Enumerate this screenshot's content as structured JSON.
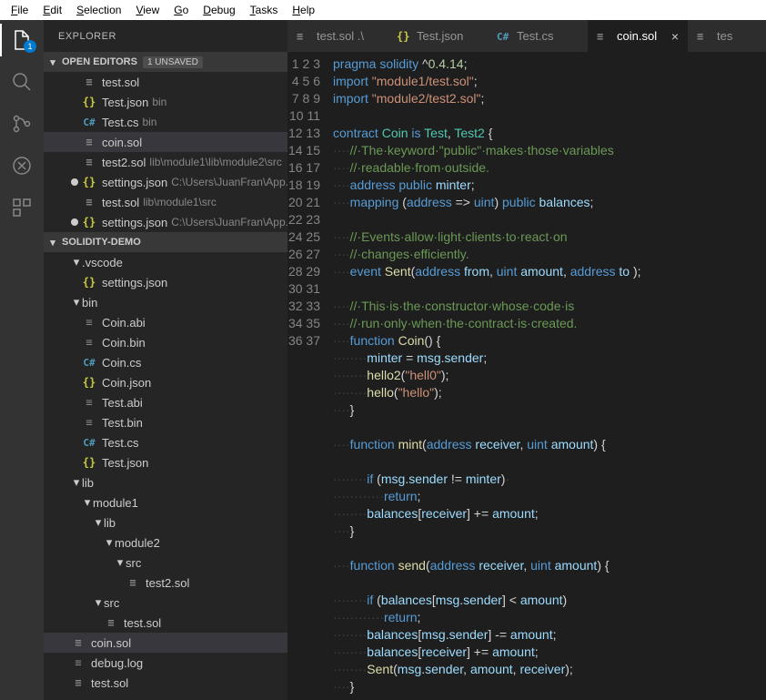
{
  "menu": [
    "File",
    "Edit",
    "Selection",
    "View",
    "Go",
    "Debug",
    "Tasks",
    "Help"
  ],
  "activity": {
    "badge": "1"
  },
  "sidebar": {
    "title": "EXPLORER",
    "openEditors": {
      "label": "OPEN EDITORS",
      "tag": "1 UNSAVED"
    },
    "editors": [
      {
        "icon": "sol",
        "name": "test.sol",
        "hint": ""
      },
      {
        "icon": "json",
        "name": "Test.json",
        "hint": "bin"
      },
      {
        "icon": "cs",
        "name": "Test.cs",
        "hint": "bin"
      },
      {
        "icon": "sol",
        "name": "coin.sol",
        "hint": "",
        "sel": true
      },
      {
        "icon": "sol",
        "name": "test2.sol",
        "hint": "lib\\module1\\lib\\module2\\src"
      },
      {
        "icon": "json",
        "name": "settings.json",
        "hint": "C:\\Users\\JuanFran\\App...",
        "dirty": true
      },
      {
        "icon": "sol",
        "name": "test.sol",
        "hint": "lib\\module1\\src"
      },
      {
        "icon": "json",
        "name": "settings.json",
        "hint": "C:\\Users\\JuanFran\\App...",
        "dirty": true
      }
    ],
    "project": {
      "label": "SOLIDITY-DEMO"
    },
    "tree": [
      {
        "d": 1,
        "t": "folder-open",
        "l": ".vscode"
      },
      {
        "d": 2,
        "t": "json",
        "l": "settings.json"
      },
      {
        "d": 1,
        "t": "folder-open",
        "l": "bin"
      },
      {
        "d": 2,
        "t": "file",
        "l": "Coin.abi"
      },
      {
        "d": 2,
        "t": "file",
        "l": "Coin.bin"
      },
      {
        "d": 2,
        "t": "cs",
        "l": "Coin.cs"
      },
      {
        "d": 2,
        "t": "json",
        "l": "Coin.json"
      },
      {
        "d": 2,
        "t": "file",
        "l": "Test.abi"
      },
      {
        "d": 2,
        "t": "file",
        "l": "Test.bin"
      },
      {
        "d": 2,
        "t": "cs",
        "l": "Test.cs"
      },
      {
        "d": 2,
        "t": "json",
        "l": "Test.json"
      },
      {
        "d": 1,
        "t": "folder-open",
        "l": "lib"
      },
      {
        "d": 2,
        "t": "folder-open",
        "l": "module1"
      },
      {
        "d": 3,
        "t": "folder-open",
        "l": "lib"
      },
      {
        "d": 4,
        "t": "folder-open",
        "l": "module2"
      },
      {
        "d": 5,
        "t": "folder-open",
        "l": "src"
      },
      {
        "d": 6,
        "t": "sol",
        "l": "test2.sol"
      },
      {
        "d": 3,
        "t": "folder-open",
        "l": "src"
      },
      {
        "d": 4,
        "t": "sol",
        "l": "test.sol"
      },
      {
        "d": 1,
        "t": "sol",
        "l": "coin.sol",
        "sel": true
      },
      {
        "d": 1,
        "t": "file",
        "l": "debug.log"
      },
      {
        "d": 1,
        "t": "sol",
        "l": "test.sol"
      }
    ]
  },
  "tabs": [
    {
      "icon": "sol",
      "label": "test.sol .\\"
    },
    {
      "icon": "json",
      "label": "Test.json"
    },
    {
      "icon": "cs",
      "label": "Test.cs"
    },
    {
      "icon": "sol",
      "label": "coin.sol",
      "active": true
    },
    {
      "icon": "sol",
      "label": "tes"
    }
  ],
  "code": [
    [
      [
        "k",
        "pragma"
      ],
      [
        "p",
        " "
      ],
      [
        "k",
        "solidity"
      ],
      [
        "p",
        " ^"
      ],
      [
        "n",
        "0.4.14"
      ],
      [
        "p",
        ";"
      ]
    ],
    [
      [
        "k",
        "import"
      ],
      [
        "p",
        " "
      ],
      [
        "s",
        "\"module1/test.sol\""
      ],
      [
        "p",
        ";"
      ]
    ],
    [
      [
        "k",
        "import"
      ],
      [
        "p",
        " "
      ],
      [
        "s",
        "\"module2/test2.sol\""
      ],
      [
        "p",
        ";"
      ]
    ],
    [],
    [
      [
        "k",
        "contract"
      ],
      [
        "p",
        " "
      ],
      [
        "t",
        "Coin"
      ],
      [
        "p",
        " "
      ],
      [
        "k",
        "is"
      ],
      [
        "p",
        " "
      ],
      [
        "t",
        "Test"
      ],
      [
        "p",
        ", "
      ],
      [
        "t",
        "Test2"
      ],
      [
        "p",
        " {"
      ]
    ],
    [
      [
        "ws",
        "····"
      ],
      [
        "c",
        "//·The·keyword·\"public\"·makes·those·variables"
      ]
    ],
    [
      [
        "ws",
        "····"
      ],
      [
        "c",
        "//·readable·from·outside."
      ]
    ],
    [
      [
        "ws",
        "····"
      ],
      [
        "k",
        "address"
      ],
      [
        "p",
        " "
      ],
      [
        "k",
        "public"
      ],
      [
        "p",
        " "
      ],
      [
        "v",
        "minter"
      ],
      [
        "p",
        ";"
      ]
    ],
    [
      [
        "ws",
        "····"
      ],
      [
        "k",
        "mapping"
      ],
      [
        "p",
        " ("
      ],
      [
        "k",
        "address"
      ],
      [
        "p",
        " => "
      ],
      [
        "k",
        "uint"
      ],
      [
        "p",
        ") "
      ],
      [
        "k",
        "public"
      ],
      [
        "p",
        " "
      ],
      [
        "v",
        "balances"
      ],
      [
        "p",
        ";"
      ]
    ],
    [],
    [
      [
        "ws",
        "····"
      ],
      [
        "c",
        "//·Events·allow·light·clients·to·react·on"
      ]
    ],
    [
      [
        "ws",
        "····"
      ],
      [
        "c",
        "//·changes·efficiently."
      ]
    ],
    [
      [
        "ws",
        "····"
      ],
      [
        "k",
        "event"
      ],
      [
        "p",
        " "
      ],
      [
        "fn",
        "Sent"
      ],
      [
        "p",
        "("
      ],
      [
        "k",
        "address"
      ],
      [
        "p",
        " "
      ],
      [
        "v",
        "from"
      ],
      [
        "p",
        ", "
      ],
      [
        "k",
        "uint"
      ],
      [
        "p",
        " "
      ],
      [
        "v",
        "amount"
      ],
      [
        "p",
        ", "
      ],
      [
        "k",
        "address"
      ],
      [
        "p",
        " "
      ],
      [
        "v",
        "to"
      ],
      [
        "p",
        " );"
      ]
    ],
    [],
    [
      [
        "ws",
        "····"
      ],
      [
        "c",
        "//·This·is·the·constructor·whose·code·is"
      ]
    ],
    [
      [
        "ws",
        "····"
      ],
      [
        "c",
        "//·run·only·when·the·contract·is·created."
      ]
    ],
    [
      [
        "ws",
        "····"
      ],
      [
        "k",
        "function"
      ],
      [
        "p",
        " "
      ],
      [
        "fn",
        "Coin"
      ],
      [
        "p",
        "() {"
      ]
    ],
    [
      [
        "ws",
        "········"
      ],
      [
        "v",
        "minter"
      ],
      [
        "p",
        " = "
      ],
      [
        "v",
        "msg"
      ],
      [
        "p",
        "."
      ],
      [
        "v",
        "sender"
      ],
      [
        "p",
        ";"
      ]
    ],
    [
      [
        "ws",
        "········"
      ],
      [
        "fn",
        "hello2"
      ],
      [
        "p",
        "("
      ],
      [
        "s",
        "\"hell0\""
      ],
      [
        "p",
        ");"
      ]
    ],
    [
      [
        "ws",
        "········"
      ],
      [
        "fn",
        "hello"
      ],
      [
        "p",
        "("
      ],
      [
        "s",
        "\"hello\""
      ],
      [
        "p",
        ");"
      ]
    ],
    [
      [
        "ws",
        "····"
      ],
      [
        "p",
        "}"
      ]
    ],
    [],
    [
      [
        "ws",
        "····"
      ],
      [
        "k",
        "function"
      ],
      [
        "p",
        " "
      ],
      [
        "fn",
        "mint"
      ],
      [
        "p",
        "("
      ],
      [
        "k",
        "address"
      ],
      [
        "p",
        " "
      ],
      [
        "v",
        "receiver"
      ],
      [
        "p",
        ", "
      ],
      [
        "k",
        "uint"
      ],
      [
        "p",
        " "
      ],
      [
        "v",
        "amount"
      ],
      [
        "p",
        ") {"
      ]
    ],
    [],
    [
      [
        "ws",
        "········"
      ],
      [
        "k",
        "if"
      ],
      [
        "p",
        " ("
      ],
      [
        "v",
        "msg"
      ],
      [
        "p",
        "."
      ],
      [
        "v",
        "sender"
      ],
      [
        "p",
        " != "
      ],
      [
        "v",
        "minter"
      ],
      [
        "p",
        ")"
      ],
      [
        "ws",
        "·"
      ]
    ],
    [
      [
        "ws",
        "············"
      ],
      [
        "k",
        "return"
      ],
      [
        "p",
        ";"
      ]
    ],
    [
      [
        "ws",
        "········"
      ],
      [
        "v",
        "balances"
      ],
      [
        "p",
        "["
      ],
      [
        "v",
        "receiver"
      ],
      [
        "p",
        "] += "
      ],
      [
        "v",
        "amount"
      ],
      [
        "p",
        ";"
      ]
    ],
    [
      [
        "ws",
        "····"
      ],
      [
        "p",
        "}"
      ]
    ],
    [],
    [
      [
        "ws",
        "····"
      ],
      [
        "k",
        "function"
      ],
      [
        "p",
        " "
      ],
      [
        "fn",
        "send"
      ],
      [
        "p",
        "("
      ],
      [
        "k",
        "address"
      ],
      [
        "p",
        " "
      ],
      [
        "v",
        "receiver"
      ],
      [
        "p",
        ", "
      ],
      [
        "k",
        "uint"
      ],
      [
        "p",
        " "
      ],
      [
        "v",
        "amount"
      ],
      [
        "p",
        ") {"
      ]
    ],
    [],
    [
      [
        "ws",
        "········"
      ],
      [
        "k",
        "if"
      ],
      [
        "p",
        " ("
      ],
      [
        "v",
        "balances"
      ],
      [
        "p",
        "["
      ],
      [
        "v",
        "msg"
      ],
      [
        "p",
        "."
      ],
      [
        "v",
        "sender"
      ],
      [
        "p",
        "] < "
      ],
      [
        "v",
        "amount"
      ],
      [
        "p",
        ")"
      ]
    ],
    [
      [
        "ws",
        "············"
      ],
      [
        "k",
        "return"
      ],
      [
        "p",
        ";"
      ]
    ],
    [
      [
        "ws",
        "········"
      ],
      [
        "v",
        "balances"
      ],
      [
        "p",
        "["
      ],
      [
        "v",
        "msg"
      ],
      [
        "p",
        "."
      ],
      [
        "v",
        "sender"
      ],
      [
        "p",
        "] -= "
      ],
      [
        "v",
        "amount"
      ],
      [
        "p",
        ";"
      ]
    ],
    [
      [
        "ws",
        "········"
      ],
      [
        "v",
        "balances"
      ],
      [
        "p",
        "["
      ],
      [
        "v",
        "receiver"
      ],
      [
        "p",
        "] += "
      ],
      [
        "v",
        "amount"
      ],
      [
        "p",
        ";"
      ]
    ],
    [
      [
        "ws",
        "········"
      ],
      [
        "fn",
        "Sent"
      ],
      [
        "p",
        "("
      ],
      [
        "v",
        "msg"
      ],
      [
        "p",
        "."
      ],
      [
        "v",
        "sender"
      ],
      [
        "p",
        ", "
      ],
      [
        "v",
        "amount"
      ],
      [
        "p",
        ", "
      ],
      [
        "v",
        "receiver"
      ],
      [
        "p",
        ");"
      ]
    ],
    [
      [
        "ws",
        "····"
      ],
      [
        "p",
        "}"
      ]
    ]
  ]
}
